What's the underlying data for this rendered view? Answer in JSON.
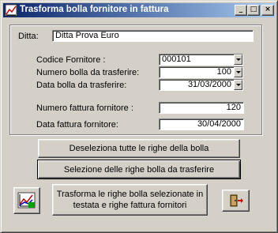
{
  "window": {
    "title": "Trasforma bolla fornitore in fattura",
    "controls": {
      "minimize": "_",
      "maximize": "□",
      "close": "×"
    }
  },
  "form": {
    "ditta_label": "Ditta:",
    "ditta_value": "Ditta Prova Euro",
    "codice_fornitore_label": "Codice Fornitore :",
    "codice_fornitore_value": "000101",
    "numero_bolla_label": "Numero bolla da trasferire:",
    "numero_bolla_value": "100",
    "data_bolla_label": "Data bolla da trasferire:",
    "data_bolla_value": "31/03/2000",
    "numero_fattura_label": "Numero fattura fornitore :",
    "numero_fattura_value": "120",
    "data_fattura_label": "Data fattura fornitore:",
    "data_fattura_value": "30/04/2000"
  },
  "buttons": {
    "deseleziona": "Deseleziona tutte le righe della bolla",
    "selezione": "Selezione delle righe bolla da trasferire",
    "trasforma_line1": "Trasforma le righe bolla selezionate in",
    "trasforma_line2": "testata e righe fattura fornitori"
  },
  "icons": {
    "app": "app-chart-icon",
    "left_button": "chart-edit-icon",
    "right_button": "exit-door-icon"
  },
  "colors": {
    "titlebar_start": "#0a246a",
    "titlebar_end": "#a6caf0",
    "face": "#d4d0c8"
  }
}
